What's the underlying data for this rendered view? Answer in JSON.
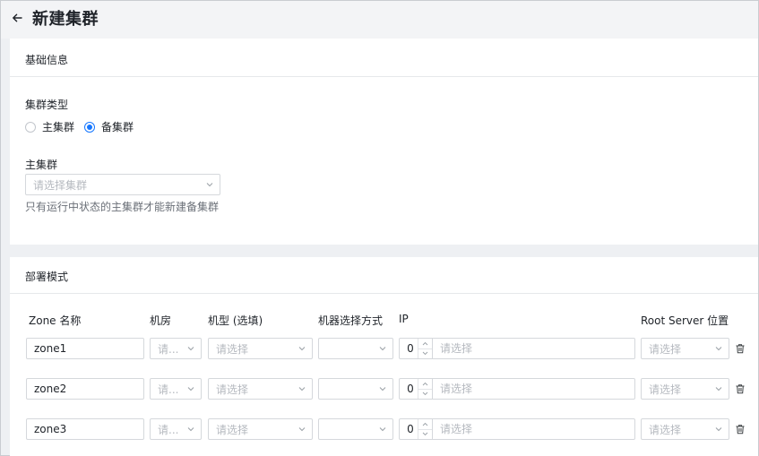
{
  "header": {
    "title": "新建集群",
    "back_icon": "arrow-left-icon"
  },
  "basic_info": {
    "section_title": "基础信息",
    "cluster_type": {
      "label": "集群类型",
      "options": [
        {
          "label": "主集群",
          "checked": false
        },
        {
          "label": "备集群",
          "checked": true
        }
      ]
    },
    "primary_cluster": {
      "label": "主集群",
      "placeholder": "请选择集群",
      "hint": "只有运行中状态的主集群才能新建备集群"
    }
  },
  "deploy": {
    "section_title": "部署模式",
    "columns": {
      "zone_name": "Zone 名称",
      "room": "机房",
      "machine_type": "机型 (选填)",
      "machine_select": "机器选择方式",
      "ip": "IP",
      "root_server": "Root Server 位置"
    },
    "rows": [
      {
        "zone": "zone1",
        "room_placeholder": "请...",
        "type_placeholder": "请选择",
        "select_value": "",
        "count": "0",
        "ip_placeholder": "请选择",
        "root_placeholder": "请选择"
      },
      {
        "zone": "zone2",
        "room_placeholder": "请...",
        "type_placeholder": "请选择",
        "select_value": "",
        "count": "0",
        "ip_placeholder": "请选择",
        "root_placeholder": "请选择"
      },
      {
        "zone": "zone3",
        "room_placeholder": "请...",
        "type_placeholder": "请选择",
        "select_value": "",
        "count": "0",
        "ip_placeholder": "请选择",
        "root_placeholder": "请选择"
      }
    ]
  },
  "colors": {
    "accent": "#1677ff",
    "border": "#d5d8dc",
    "placeholder": "#b5b9bf",
    "page_bg": "#eef0f3"
  }
}
